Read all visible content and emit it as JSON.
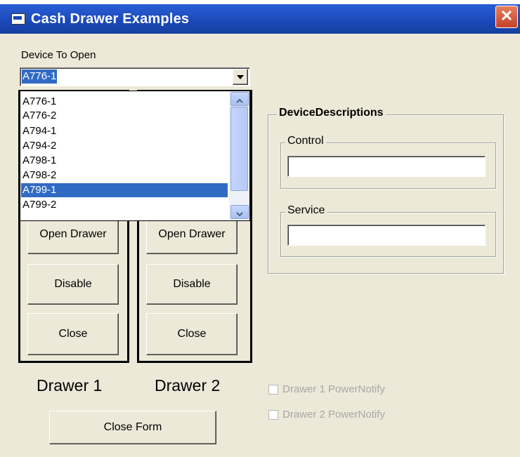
{
  "window": {
    "title": "Cash Drawer Examples",
    "close_glyph": "✕",
    "icon": "app-window-icon"
  },
  "device": {
    "label": "Device To Open",
    "selected": "A776-1",
    "options": [
      "A776-1",
      "A776-2",
      "A794-1",
      "A794-2",
      "A798-1",
      "A798-2",
      "A799-1",
      "A799-2"
    ],
    "highlighted": "A799-1"
  },
  "drawer1": {
    "open_label": "Open Drawer",
    "disable_label": "Disable",
    "close_label": "Close",
    "caption": "Drawer 1"
  },
  "drawer2": {
    "open_label": "Open Drawer",
    "disable_label": "Disable",
    "close_label": "Close",
    "caption": "Drawer 2"
  },
  "close_form_label": "Close Form",
  "descriptions": {
    "title": "DeviceDescriptions",
    "control_label": "Control",
    "control_value": "",
    "service_label": "Service",
    "service_value": ""
  },
  "power_notify": {
    "drawer1_label": "Drawer 1 PowerNotify",
    "drawer1_checked": false,
    "drawer2_label": "Drawer 2 PowerNotify",
    "drawer2_checked": false
  },
  "colors": {
    "titlebar": "#1b48b8",
    "selection": "#316AC5",
    "face": "#ECE9D8"
  }
}
